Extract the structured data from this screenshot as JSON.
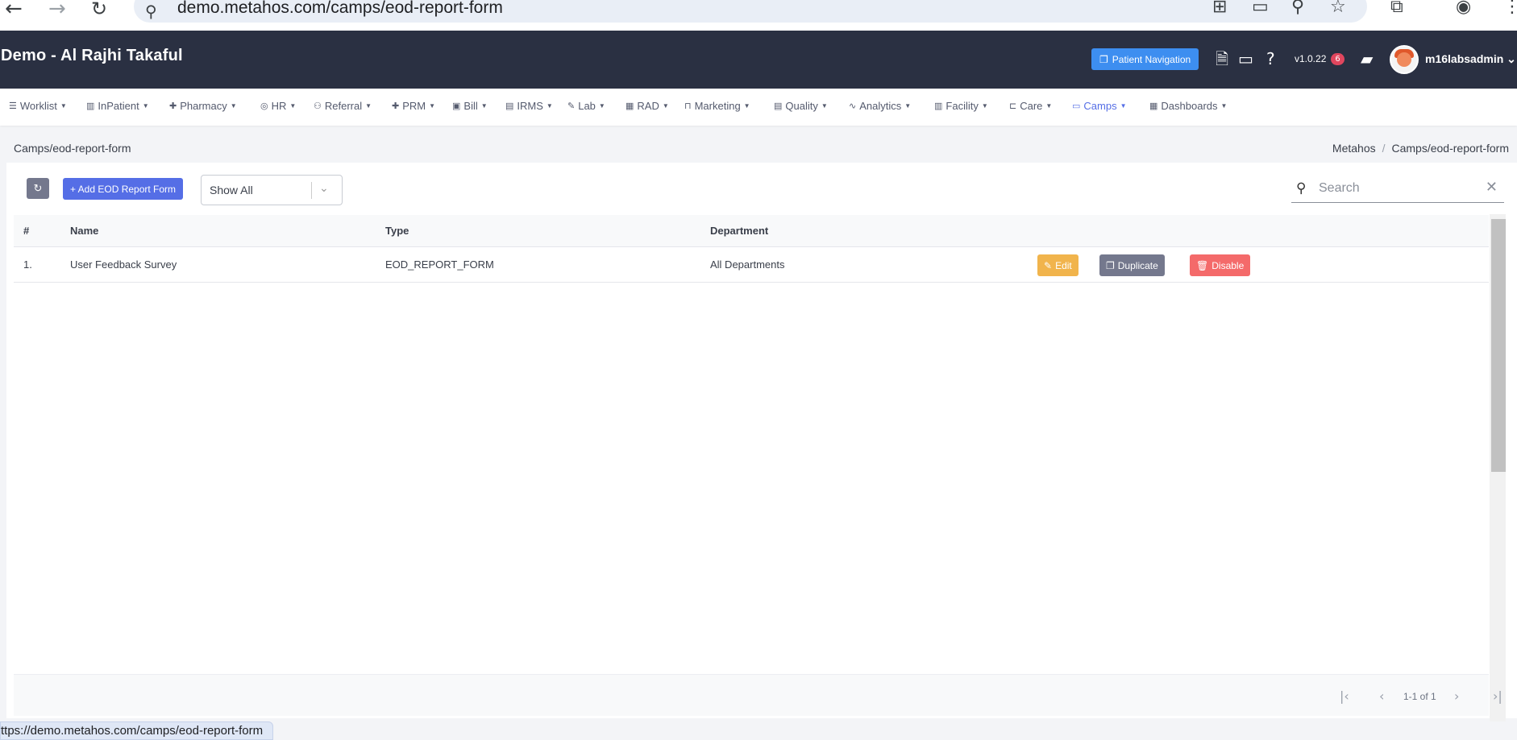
{
  "browser": {
    "url": "demo.metahos.com/camps/eod-report-form",
    "status_url": "ttps://demo.metahos.com/camps/eod-report-form"
  },
  "header": {
    "title": "Demo - Al Rajhi Takaful",
    "patient_navigation": "Patient Navigation",
    "version": "v1.0.22",
    "notification_count": "6",
    "username": "m16labsadmin"
  },
  "menu": [
    {
      "label": "Worklist",
      "icon": "list-icon"
    },
    {
      "label": "InPatient",
      "icon": "building-icon"
    },
    {
      "label": "Pharmacy",
      "icon": "plus-icon"
    },
    {
      "label": "HR",
      "icon": "user-circle-icon"
    },
    {
      "label": "Referral",
      "icon": "users-icon"
    },
    {
      "label": "PRM",
      "icon": "plus-icon"
    },
    {
      "label": "Bill",
      "icon": "money-icon"
    },
    {
      "label": "IRMS",
      "icon": "id-card-icon"
    },
    {
      "label": "Lab",
      "icon": "pencil-icon"
    },
    {
      "label": "RAD",
      "icon": "film-icon"
    },
    {
      "label": "Marketing",
      "icon": "bag-icon"
    },
    {
      "label": "Quality",
      "icon": "checklist-icon"
    },
    {
      "label": "Analytics",
      "icon": "pulse-icon"
    },
    {
      "label": "Facility",
      "icon": "building-icon"
    },
    {
      "label": "Care",
      "icon": "bed-icon"
    },
    {
      "label": "Camps",
      "icon": "briefcase-icon",
      "active": true
    },
    {
      "label": "Dashboards",
      "icon": "grid-icon"
    }
  ],
  "page": {
    "title": "Camps/eod-report-form",
    "breadcrumb": [
      "Metahos",
      "Camps/eod-report-form"
    ]
  },
  "toolbar": {
    "add_label": "+ Add EOD Report Form",
    "filter_value": "Show All",
    "search_placeholder": "Search"
  },
  "table": {
    "columns": [
      "#",
      "Name",
      "Type",
      "Department"
    ],
    "rows": [
      {
        "index": "1.",
        "name": "User Feedback Survey",
        "type": "EOD_REPORT_FORM",
        "department": "All Departments"
      }
    ],
    "actions": {
      "edit": "Edit",
      "duplicate": "Duplicate",
      "disable": "Disable"
    }
  },
  "pagination": {
    "range": "1-1 of 1"
  },
  "colors": {
    "header_bg": "#2a3042",
    "primary": "#556ee6",
    "warning": "#f1b44c",
    "secondary": "#74788d",
    "danger": "#f46a6a",
    "info": "#3d8ef0"
  }
}
